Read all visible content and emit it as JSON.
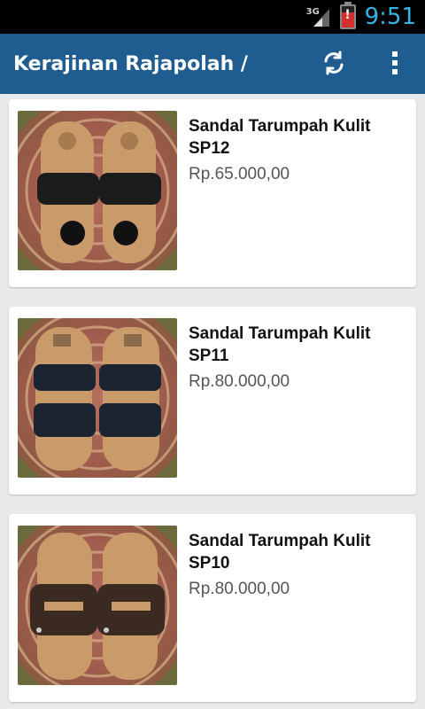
{
  "status_bar": {
    "network": "3G",
    "time": "9:51"
  },
  "action_bar": {
    "title": "Kerajinan Rajapolah /",
    "refresh_icon": "refresh-icon",
    "overflow_icon": "more-vert-icon"
  },
  "products": [
    {
      "name": "Sandal Tarumpah Kulit SP12",
      "price": "Rp.65.000,00"
    },
    {
      "name": "Sandal Tarumpah Kulit SP11",
      "price": "Rp.80.000,00"
    },
    {
      "name": "Sandal Tarumpah Kulit SP10",
      "price": "Rp.80.000,00"
    }
  ],
  "colors": {
    "action_bar": "#1f5c8f",
    "status_accent": "#33b5e5",
    "background": "#e9e9e9"
  }
}
